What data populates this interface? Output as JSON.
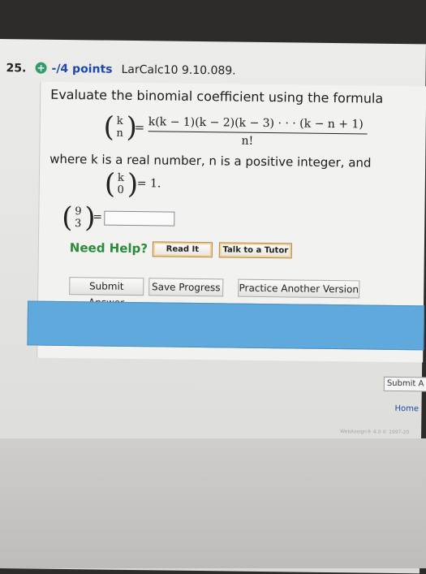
{
  "question": {
    "number": "25.",
    "plus_icon": "+",
    "points": "-/4 points",
    "source": "LarCalc10 9.10.089."
  },
  "problem": {
    "intro": "Evaluate the binomial coefficient using the formula",
    "binom_top": "k",
    "binom_bottom": "n",
    "equals": "=",
    "numerator": "k(k − 1)(k − 2)(k − 3) · · · (k − n + 1)",
    "denominator": "n!",
    "where_text": "where k is a real number, n is a positive integer, and",
    "base_top": "k",
    "base_bottom": "0",
    "base_value": "= 1.",
    "ask_top": "9",
    "ask_bottom": "3",
    "ask_equals": "="
  },
  "answer": {
    "value": ""
  },
  "help": {
    "label": "Need Help?",
    "read_it": "Read It",
    "tutor": "Talk to a Tutor"
  },
  "actions": {
    "submit_answer": "Submit Answer",
    "save_progress": "Save Progress",
    "practice_another": "Practice Another Version"
  },
  "lower": {
    "submit_assignment": "Submit A",
    "home": "Home",
    "footer": "WebAssign® 4.0 © 1997-20"
  },
  "colors": {
    "points": "#1f47a8",
    "need_help": "#2a8c3a",
    "bar": "#5fa9dc"
  }
}
